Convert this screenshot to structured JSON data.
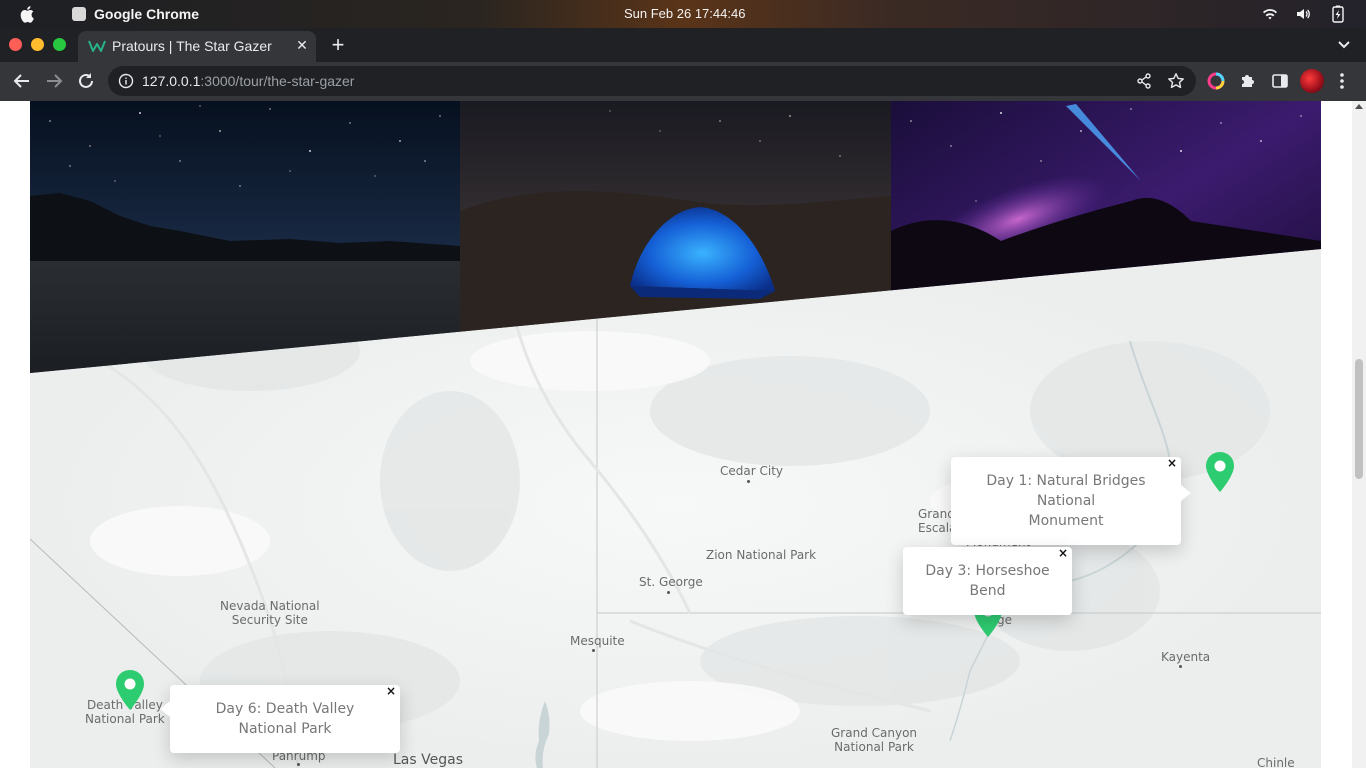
{
  "os": {
    "app_name": "Google Chrome",
    "clock": "Sun Feb 26  17:44:46"
  },
  "browser": {
    "tab_title": "Pratours | The Star Gazer",
    "url_host": "127.0.0.1",
    "url_path": ":3000/tour/the-star-gazer"
  },
  "map": {
    "places": [
      {
        "name": "Cedar City"
      },
      {
        "name": "Grand Staircase-Escalante National Monument",
        "lines": [
          "Grand",
          "Escalante National",
          "Monument"
        ]
      },
      {
        "name": "Zion National Park"
      },
      {
        "name": "St. George"
      },
      {
        "name": "Nevada National Security Site",
        "lines": [
          "Nevada National",
          "Security Site"
        ]
      },
      {
        "name": "Mesquite"
      },
      {
        "name": "Death Valley National Park",
        "lines": [
          "Death Valley",
          "National Park"
        ]
      },
      {
        "name": "Pahrump"
      },
      {
        "name": "Las Vegas"
      },
      {
        "name": "Grand Canyon National Park",
        "lines": [
          "Grand Canyon",
          "National Park"
        ]
      },
      {
        "name": "Kayenta"
      },
      {
        "name": "Chinle"
      },
      {
        "name": "Page",
        "partial": "ge"
      }
    ],
    "popups": [
      {
        "text": "Day 1: Natural Bridges National Monument",
        "lines": [
          "Day 1: Natural Bridges National",
          "Monument"
        ]
      },
      {
        "text": "Day 3: Horseshoe Bend"
      },
      {
        "text": "Day 6: Death Valley National Park"
      }
    ],
    "popup_close_glyph": "×",
    "marker_color": "#2ecc71"
  }
}
